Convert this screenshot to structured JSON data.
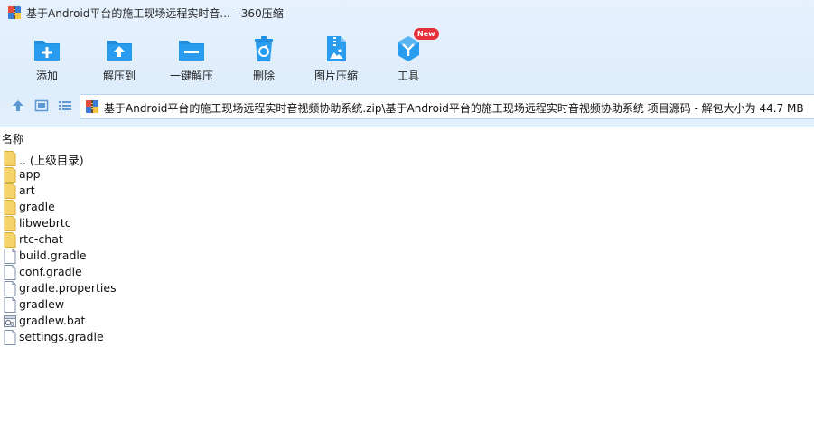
{
  "window": {
    "title": "基于Android平台的施工现场远程实时音... - 360压缩"
  },
  "toolbar": {
    "buttons": [
      {
        "label": "添加",
        "icon": "add-icon"
      },
      {
        "label": "解压到",
        "icon": "extract-to-icon"
      },
      {
        "label": "一键解压",
        "icon": "one-click-extract-icon"
      },
      {
        "label": "删除",
        "icon": "delete-icon"
      },
      {
        "label": "图片压缩",
        "icon": "image-compress-icon"
      },
      {
        "label": "工具",
        "icon": "tools-icon",
        "badge": "New"
      }
    ]
  },
  "address": {
    "path": "基于Android平台的施工现场远程实时音视频协助系统.zip\\基于Android平台的施工现场远程实时音视频协助系统 项目源码 - 解包大小为 44.7 MB"
  },
  "list": {
    "column_name": "名称",
    "items": [
      {
        "name": ".. (上级目录)",
        "type": "folder"
      },
      {
        "name": "app",
        "type": "folder"
      },
      {
        "name": "art",
        "type": "folder"
      },
      {
        "name": "gradle",
        "type": "folder"
      },
      {
        "name": "libwebrtc",
        "type": "folder"
      },
      {
        "name": "rtc-chat",
        "type": "folder"
      },
      {
        "name": "build.gradle",
        "type": "file"
      },
      {
        "name": "conf.gradle",
        "type": "file"
      },
      {
        "name": "gradle.properties",
        "type": "file"
      },
      {
        "name": "gradlew",
        "type": "file"
      },
      {
        "name": "gradlew.bat",
        "type": "bat"
      },
      {
        "name": "settings.gradle",
        "type": "file"
      }
    ]
  },
  "colors": {
    "toolbar_bg": "#deedfc",
    "icon_blue": "#1e8fe0",
    "folder_yellow": "#f7d36b",
    "badge_red": "#e8303a"
  }
}
